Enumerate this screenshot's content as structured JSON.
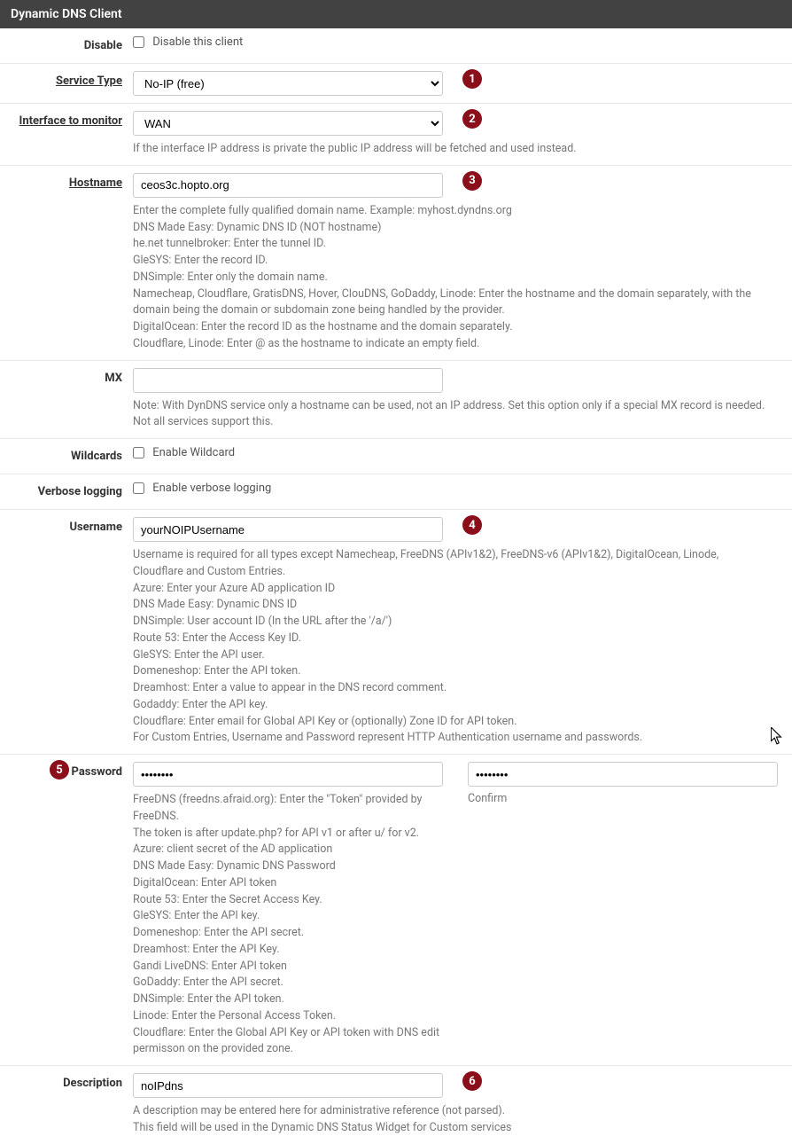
{
  "panel": {
    "title": "Dynamic DNS Client"
  },
  "badges": {
    "b1": "1",
    "b2": "2",
    "b3": "3",
    "b4": "4",
    "b5": "5",
    "b6": "6"
  },
  "labels": {
    "disable": "Disable",
    "service_type": "Service Type",
    "interface": "Interface to monitor",
    "hostname": "Hostname",
    "mx": "MX",
    "wildcards": "Wildcards",
    "verbose": "Verbose logging",
    "username": "Username",
    "password": "Password",
    "description": "Description"
  },
  "fields": {
    "disable_checkbox_label": "Disable this client",
    "service_type_value": "No-IP (free)",
    "interface_value": "WAN",
    "hostname_value": "ceos3c.hopto.org",
    "mx_value": "",
    "wildcards_checkbox_label": "Enable Wildcard",
    "verbose_checkbox_label": "Enable verbose logging",
    "username_value": "yourNOIPUsername",
    "password_value": "••••••••",
    "password_confirm_value": "••••••••",
    "password_confirm_label": "Confirm",
    "description_value": "noIPdns"
  },
  "help": {
    "interface": "If the interface IP address is private the public IP address will be fetched and used instead.",
    "hostname": [
      "Enter the complete fully qualified domain name. Example: myhost.dyndns.org",
      "DNS Made Easy: Dynamic DNS ID (NOT hostname)",
      "he.net tunnelbroker: Enter the tunnel ID.",
      "GleSYS: Enter the record ID.",
      "DNSimple: Enter only the domain name.",
      "Namecheap, Cloudflare, GratisDNS, Hover, ClouDNS, GoDaddy, Linode: Enter the hostname and the domain separately, with the domain being the domain or subdomain zone being handled by the provider.",
      "DigitalOcean: Enter the record ID as the hostname and the domain separately.",
      "Cloudflare, Linode: Enter @ as the hostname to indicate an empty field."
    ],
    "mx": "Note: With DynDNS service only a hostname can be used, not an IP address. Set this option only if a special MX record is needed. Not all services support this.",
    "username": [
      "Username is required for all types except Namecheap, FreeDNS (APIv1&2), FreeDNS-v6 (APIv1&2), DigitalOcean, Linode, Cloudflare and Custom Entries.",
      "Azure: Enter your Azure AD application ID",
      "DNS Made Easy: Dynamic DNS ID",
      "DNSimple: User account ID (In the URL after the '/a/')",
      "Route 53: Enter the Access Key ID.",
      "GleSYS: Enter the API user.",
      "Domeneshop: Enter the API token.",
      "Dreamhost: Enter a value to appear in the DNS record comment.",
      "Godaddy: Enter the API key.",
      "Cloudflare: Enter email for Global API Key or (optionally) Zone ID for API token.",
      "For Custom Entries, Username and Password represent HTTP Authentication username and passwords."
    ],
    "password": [
      "FreeDNS (freedns.afraid.org): Enter the \"Token\" provided by FreeDNS.",
      "The token is after update.php? for API v1 or after u/ for v2.",
      "Azure: client secret of the AD application",
      "DNS Made Easy: Dynamic DNS Password",
      "DigitalOcean: Enter API token",
      "Route 53: Enter the Secret Access Key.",
      "GleSYS: Enter the API key.",
      "Domeneshop: Enter the API secret.",
      "Dreamhost: Enter the API Key.",
      "Gandi LiveDNS: Enter API token",
      "GoDaddy: Enter the API secret.",
      "DNSimple: Enter the API token.",
      "Linode: Enter the Personal Access Token.",
      "Cloudflare: Enter the Global API Key or API token with DNS edit permisson on the provided zone."
    ],
    "description": [
      "A description may be entered here for administrative reference (not parsed).",
      "This field will be used in the Dynamic DNS Status Widget for Custom services"
    ]
  }
}
